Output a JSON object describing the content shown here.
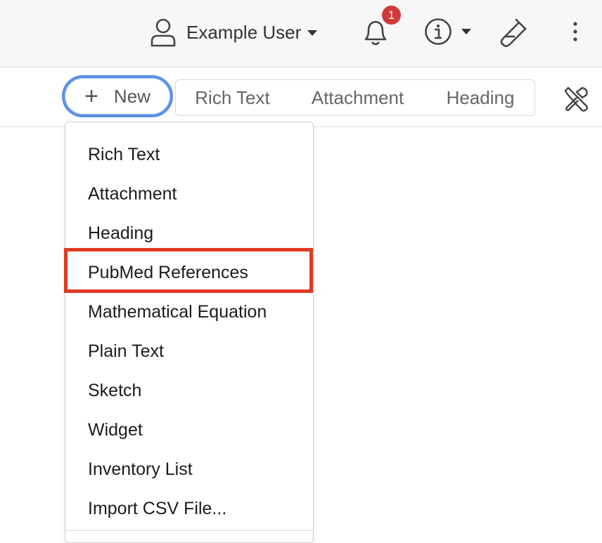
{
  "header": {
    "user_name": "Example User",
    "notifications_count": "1",
    "accent_color": "#5b8fe6",
    "badge_color": "#d0393a",
    "icons": [
      "user-icon",
      "bell-icon",
      "info-icon",
      "flask-icon",
      "kebab-icon"
    ]
  },
  "toolbar": {
    "new_label": "New",
    "segments": [
      "Rich Text",
      "Attachment",
      "Heading"
    ],
    "icons": [
      "plus-icon",
      "tools-icon"
    ]
  },
  "new_menu": {
    "items": [
      "Rich Text",
      "Attachment",
      "Heading",
      "PubMed References",
      "Mathematical Equation",
      "Plain Text",
      "Sketch",
      "Widget",
      "Inventory List",
      "Import CSV File..."
    ],
    "highlighted_item": "PubMed References",
    "highlight_color": "#e03b24"
  }
}
